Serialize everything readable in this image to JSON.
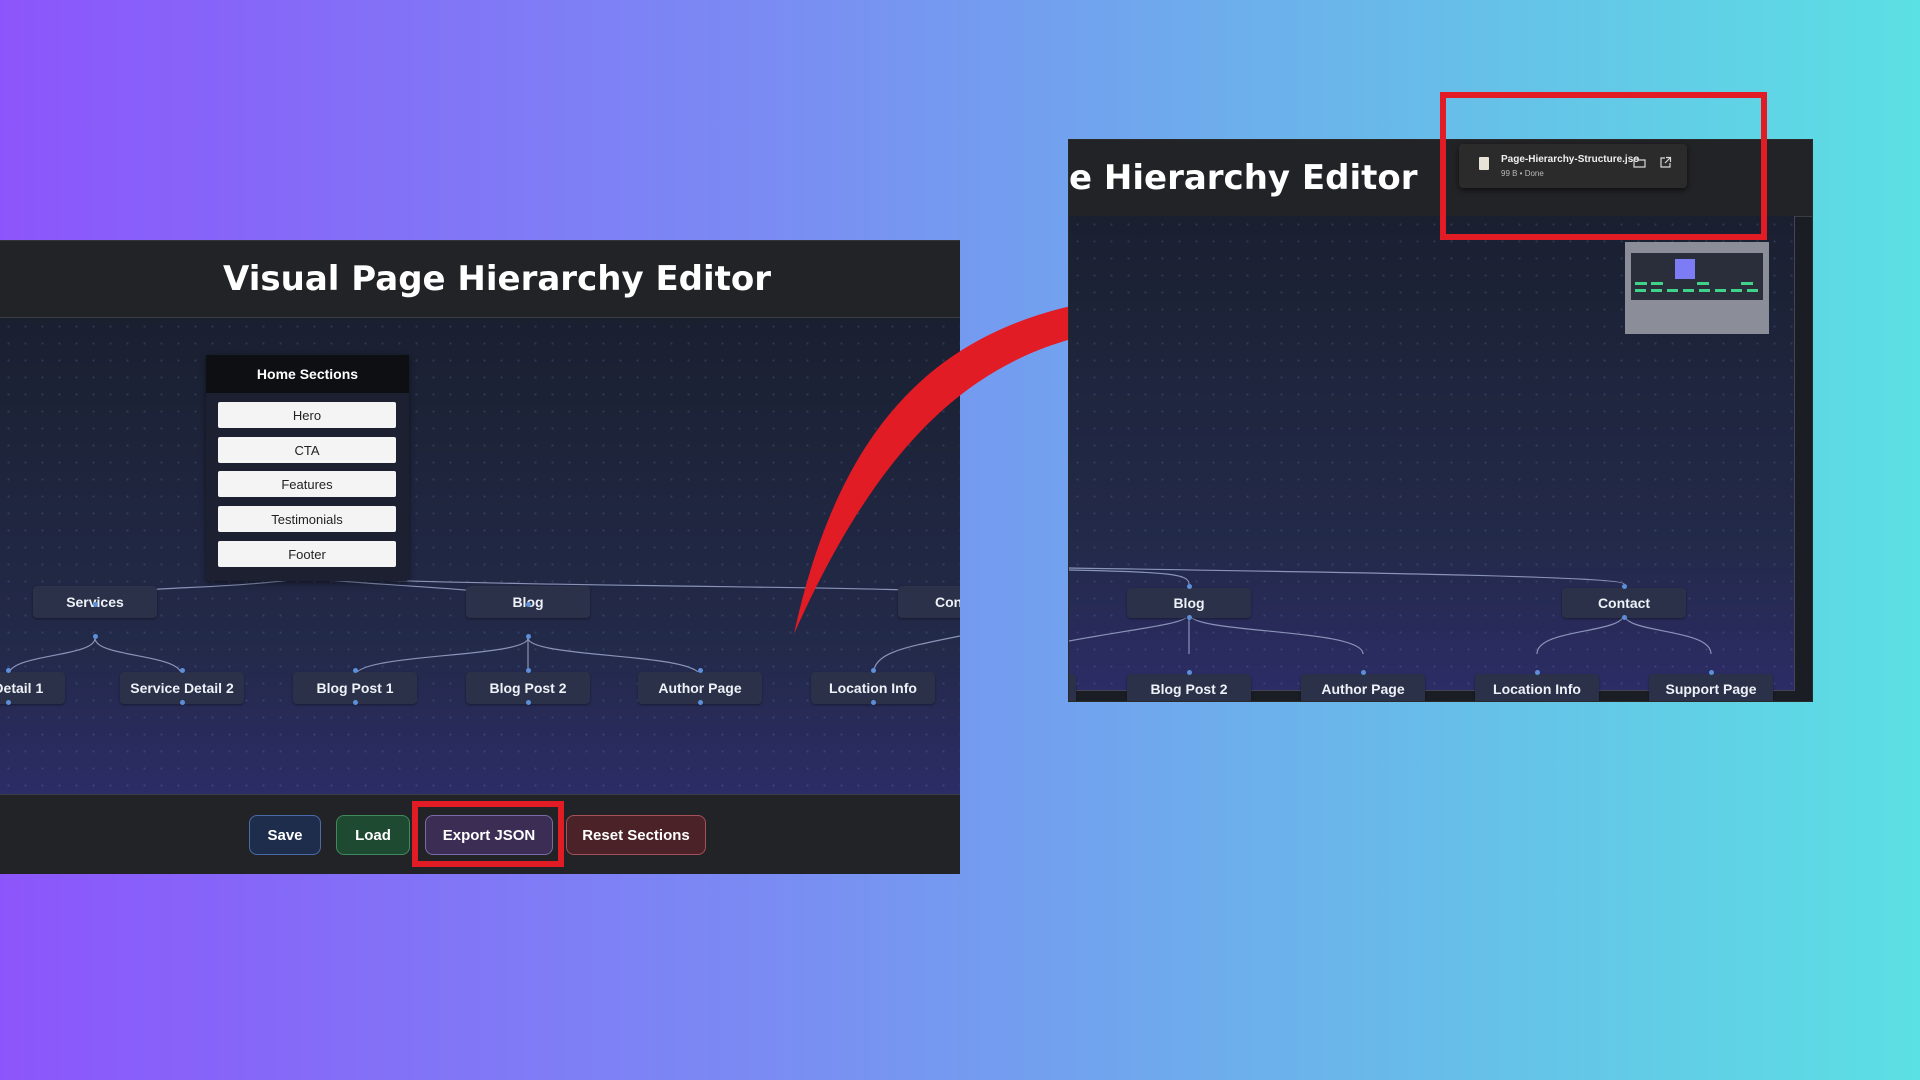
{
  "editor": {
    "title": "Visual Page Hierarchy Editor",
    "title_cropped": "e Hierarchy Editor"
  },
  "home_sections": {
    "header": "Home Sections",
    "items": [
      "Hero",
      "CTA",
      "Features",
      "Testimonials",
      "Footer"
    ]
  },
  "left_tree": {
    "level1": [
      "Services",
      "Blog",
      "Con"
    ],
    "level2": [
      "e Detail 1",
      "Service Detail 2",
      "Blog Post 1",
      "Blog Post 2",
      "Author Page",
      "Location Info"
    ]
  },
  "toolbar": {
    "save": "Save",
    "load": "Load",
    "export": "Export JSON",
    "reset": "Reset Sections"
  },
  "right_tree": {
    "level1": [
      "Blog",
      "Contact"
    ],
    "level2": [
      "Blog Post 2",
      "Author Page",
      "Location Info",
      "Support Page"
    ]
  },
  "download": {
    "filename": "Page-Hierarchy-Structure.jso",
    "status": "99 B • Done"
  },
  "colors": {
    "highlight": "#e11c25",
    "node_bg": "#2a3148",
    "connector": "#5c8fd8"
  }
}
